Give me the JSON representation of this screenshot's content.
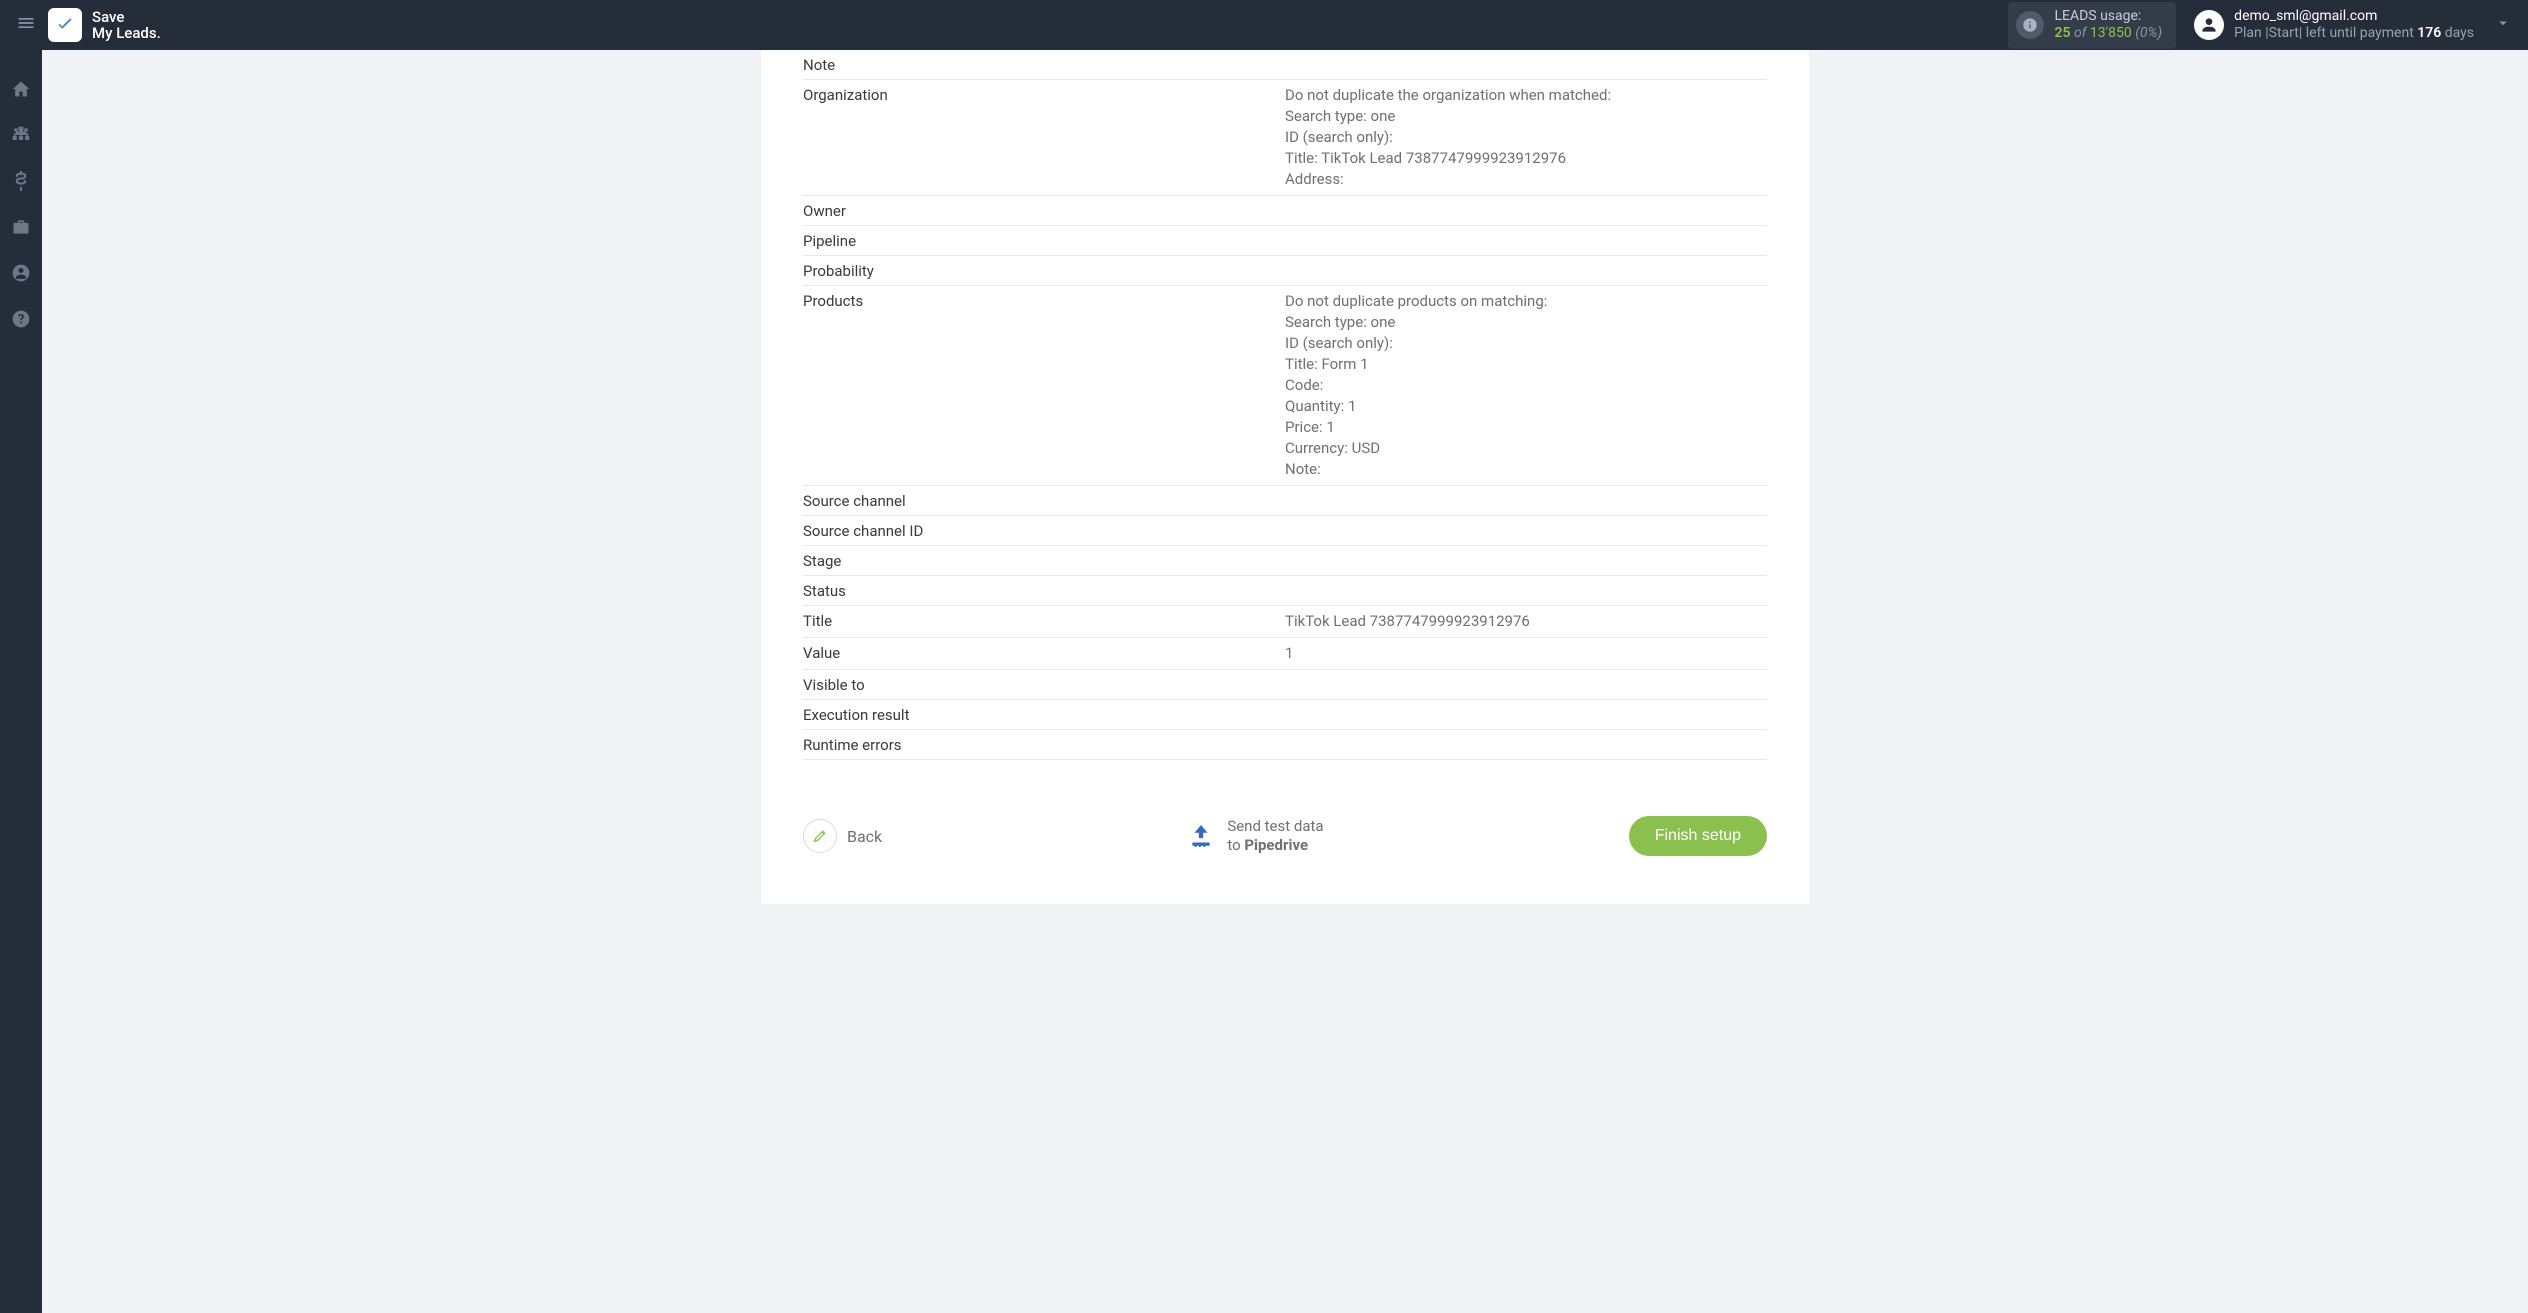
{
  "header": {
    "logo_line1": "Save",
    "logo_line2": "My Leads.",
    "usage": {
      "label": "LEADS usage:",
      "current": "25",
      "of": "of",
      "total": "13'850",
      "percent": "(0%)"
    },
    "user": {
      "email": "demo_sml@gmail.com",
      "plan_prefix": "Plan |Start| left until payment ",
      "days": "176",
      "plan_suffix": " days"
    }
  },
  "rows": {
    "note": {
      "label": "Note",
      "value": ""
    },
    "organization": {
      "label": "Organization",
      "lines": [
        "Do not duplicate the organization when matched:",
        "Search type: one",
        "ID (search only):",
        "Title: TikTok Lead 7387747999923912976",
        "Address:"
      ]
    },
    "owner": {
      "label": "Owner",
      "value": ""
    },
    "pipeline": {
      "label": "Pipeline",
      "value": ""
    },
    "probability": {
      "label": "Probability",
      "value": ""
    },
    "products": {
      "label": "Products",
      "lines": [
        "Do not duplicate products on matching:",
        "Search type: one",
        "ID (search only):",
        "Title: Form 1",
        "Code:",
        "Quantity: 1",
        "Price: 1",
        "Currency: USD",
        "Note:"
      ]
    },
    "source_channel": {
      "label": "Source channel",
      "value": ""
    },
    "source_channel_id": {
      "label": "Source channel ID",
      "value": ""
    },
    "stage": {
      "label": "Stage",
      "value": ""
    },
    "status": {
      "label": "Status",
      "value": ""
    },
    "title": {
      "label": "Title",
      "value": "TikTok Lead 7387747999923912976"
    },
    "value": {
      "label": "Value",
      "value": "1"
    },
    "visible_to": {
      "label": "Visible to",
      "value": ""
    },
    "execution_result": {
      "label": "Execution result",
      "value": ""
    },
    "runtime_errors": {
      "label": "Runtime errors",
      "value": ""
    }
  },
  "actions": {
    "back": "Back",
    "send_line1": "Send test data",
    "send_line2_prefix": "to ",
    "send_line2_bold": "Pipedrive",
    "finish": "Finish setup"
  }
}
